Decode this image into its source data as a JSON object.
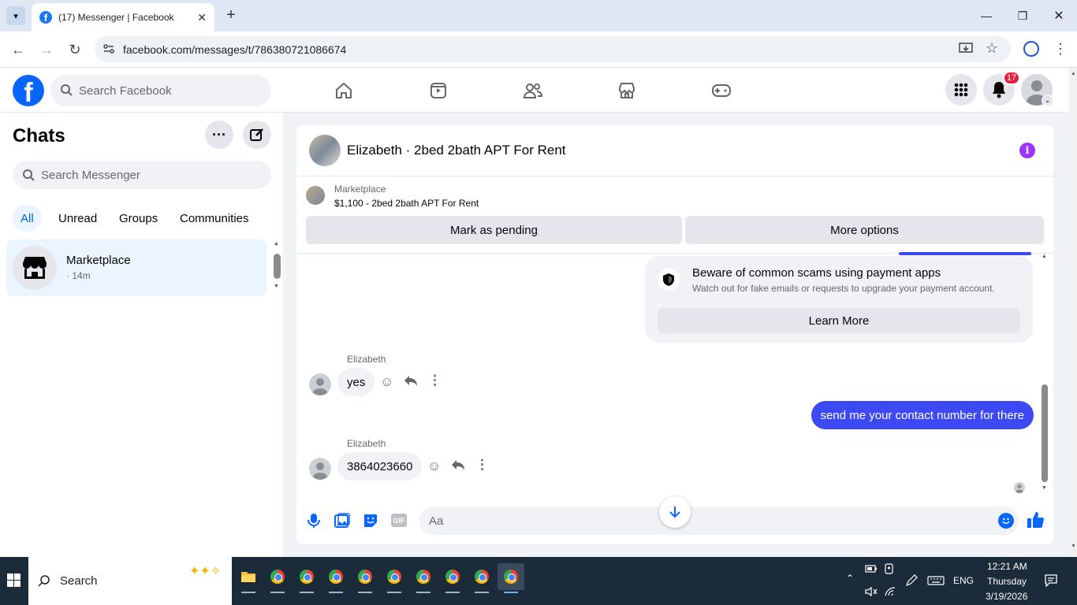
{
  "browser": {
    "tab_title": "(17) Messenger | Facebook",
    "url": "facebook.com/messages/t/786380721086674"
  },
  "fb_header": {
    "search_placeholder": "Search Facebook",
    "notification_count": "17"
  },
  "sidebar": {
    "title": "Chats",
    "search_placeholder": "Search Messenger",
    "filters": [
      "All",
      "Unread",
      "Groups",
      "Communities"
    ],
    "active_filter": "All",
    "conversations": [
      {
        "name": "Marketplace",
        "meta": "· 14m"
      }
    ]
  },
  "conversation": {
    "title": "Elizabeth · 2bed 2bath APT For Rent",
    "marketplace_label": "Marketplace",
    "listing": "$1,100 - 2bed 2bath APT For Rent",
    "mark_pending_label": "Mark as pending",
    "more_options_label": "More options",
    "notice": {
      "title": "Beware of common scams using payment apps",
      "body": "Watch out for fake emails or requests to upgrade your payment account.",
      "button": "Learn More"
    },
    "messages": [
      {
        "sender": "Elizabeth",
        "text": "yes",
        "outgoing": false
      },
      {
        "sender": "",
        "text": "send me your contact number for there",
        "outgoing": true
      },
      {
        "sender": "Elizabeth",
        "text": "3864023660",
        "outgoing": false
      }
    ],
    "composer_placeholder": "Aa"
  },
  "taskbar": {
    "search_label": "Search",
    "lang": "ENG",
    "time": "12:21 AM",
    "day": "Thursday",
    "date": "3/19/2026"
  },
  "colors": {
    "fb_blue": "#0866ff",
    "outgoing_bubble": "#3d49f2",
    "info_purple": "#a033ff"
  }
}
